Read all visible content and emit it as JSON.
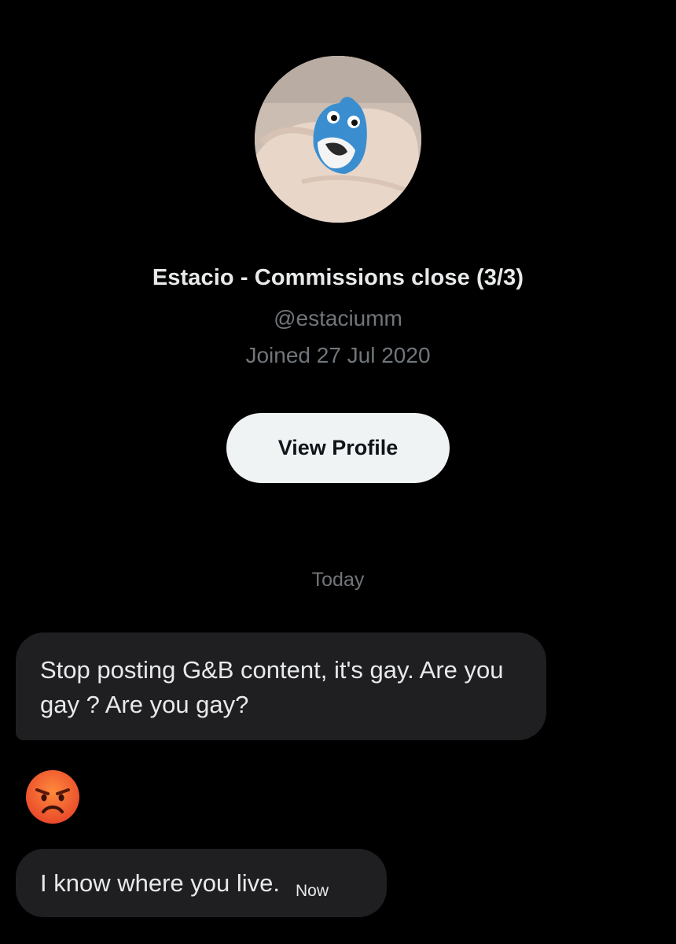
{
  "profile": {
    "name": "Estacio - Commissions close (3/3)",
    "handle": "@estaciumm",
    "joined": "Joined 27 Jul 2020",
    "view_profile_label": "View Profile"
  },
  "conversation": {
    "date_divider": "Today",
    "messages": [
      {
        "text": "Stop posting G&B content, it's gay. Are you gay ? Are you gay?"
      },
      {
        "emoji_icon": "angry-face-icon"
      },
      {
        "text": "I know where you live.",
        "time": "Now"
      }
    ]
  },
  "colors": {
    "background": "#000000",
    "bubble": "#1f1f22",
    "muted_text": "#71767b",
    "button_bg": "#eff3f4"
  }
}
